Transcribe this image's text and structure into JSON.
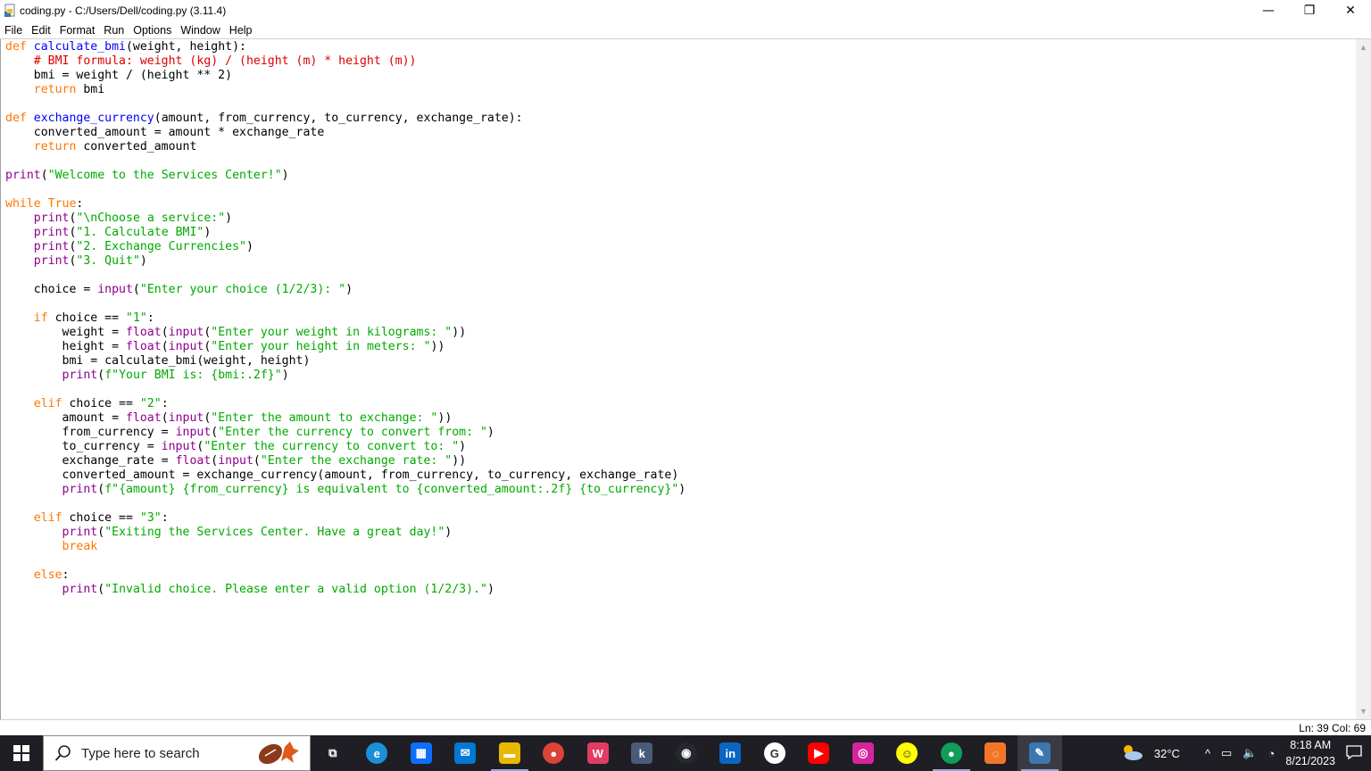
{
  "window": {
    "title": "coding.py - C:/Users/Dell/coding.py (3.11.4)",
    "minimize_symbol": "—",
    "restore_symbol": "❐",
    "close_symbol": "✕"
  },
  "menu": [
    "File",
    "Edit",
    "Format",
    "Run",
    "Options",
    "Window",
    "Help"
  ],
  "colors": {
    "keyword": "#ff7700",
    "builtin": "#900090",
    "string": "#00aa00",
    "comment": "#dd0000",
    "definition": "#0000ff",
    "taskbar": "#1e1e24"
  },
  "code_lines": [
    [
      [
        "kw",
        "def "
      ],
      [
        "df",
        "calculate_bmi"
      ],
      [
        "",
        "(weight, height):"
      ]
    ],
    [
      [
        "",
        "    "
      ],
      [
        "cm",
        "# BMI formula: weight (kg) / (height (m) * height (m))"
      ]
    ],
    [
      [
        "",
        "    bmi = weight / (height ** 2)"
      ]
    ],
    [
      [
        "",
        "    "
      ],
      [
        "kw",
        "return"
      ],
      [
        "",
        " bmi"
      ]
    ],
    [],
    [
      [
        "kw",
        "def "
      ],
      [
        "df",
        "exchange_currency"
      ],
      [
        "",
        "(amount, from_currency, to_currency, exchange_rate):"
      ]
    ],
    [
      [
        "",
        "    converted_amount = amount * exchange_rate"
      ]
    ],
    [
      [
        "",
        "    "
      ],
      [
        "kw",
        "return"
      ],
      [
        "",
        " converted_amount"
      ]
    ],
    [],
    [
      [
        "bi",
        "print"
      ],
      [
        "",
        "("
      ],
      [
        "st",
        "\"Welcome to the Services Center!\""
      ],
      [
        "",
        ")"
      ]
    ],
    [],
    [
      [
        "kw",
        "while"
      ],
      [
        "",
        " "
      ],
      [
        "kw",
        "True"
      ],
      [
        "",
        ":"
      ]
    ],
    [
      [
        "",
        "    "
      ],
      [
        "bi",
        "print"
      ],
      [
        "",
        "("
      ],
      [
        "st",
        "\"\\nChoose a service:\""
      ],
      [
        "",
        ")"
      ]
    ],
    [
      [
        "",
        "    "
      ],
      [
        "bi",
        "print"
      ],
      [
        "",
        "("
      ],
      [
        "st",
        "\"1. Calculate BMI\""
      ],
      [
        "",
        ")"
      ]
    ],
    [
      [
        "",
        "    "
      ],
      [
        "bi",
        "print"
      ],
      [
        "",
        "("
      ],
      [
        "st",
        "\"2. Exchange Currencies\""
      ],
      [
        "",
        ")"
      ]
    ],
    [
      [
        "",
        "    "
      ],
      [
        "bi",
        "print"
      ],
      [
        "",
        "("
      ],
      [
        "st",
        "\"3. Quit\""
      ],
      [
        "",
        ")"
      ]
    ],
    [],
    [
      [
        "",
        "    choice = "
      ],
      [
        "bi",
        "input"
      ],
      [
        "",
        "("
      ],
      [
        "st",
        "\"Enter your choice (1/2/3): \""
      ],
      [
        "",
        ")"
      ]
    ],
    [],
    [
      [
        "",
        "    "
      ],
      [
        "kw",
        "if"
      ],
      [
        "",
        " choice == "
      ],
      [
        "st",
        "\"1\""
      ],
      [
        "",
        ":"
      ]
    ],
    [
      [
        "",
        "        weight = "
      ],
      [
        "bi",
        "float"
      ],
      [
        "",
        "("
      ],
      [
        "bi",
        "input"
      ],
      [
        "",
        "("
      ],
      [
        "st",
        "\"Enter your weight in kilograms: \""
      ],
      [
        "",
        "))"
      ]
    ],
    [
      [
        "",
        "        height = "
      ],
      [
        "bi",
        "float"
      ],
      [
        "",
        "("
      ],
      [
        "bi",
        "input"
      ],
      [
        "",
        "("
      ],
      [
        "st",
        "\"Enter your height in meters: \""
      ],
      [
        "",
        "))"
      ]
    ],
    [
      [
        "",
        "        bmi = calculate_bmi(weight, height)"
      ]
    ],
    [
      [
        "",
        "        "
      ],
      [
        "bi",
        "print"
      ],
      [
        "",
        "("
      ],
      [
        "st",
        "f\"Your BMI is: {bmi:.2f}\""
      ],
      [
        "",
        ")"
      ]
    ],
    [],
    [
      [
        "",
        "    "
      ],
      [
        "kw",
        "elif"
      ],
      [
        "",
        " choice == "
      ],
      [
        "st",
        "\"2\""
      ],
      [
        "",
        ":"
      ]
    ],
    [
      [
        "",
        "        amount = "
      ],
      [
        "bi",
        "float"
      ],
      [
        "",
        "("
      ],
      [
        "bi",
        "input"
      ],
      [
        "",
        "("
      ],
      [
        "st",
        "\"Enter the amount to exchange: \""
      ],
      [
        "",
        "))"
      ]
    ],
    [
      [
        "",
        "        from_currency = "
      ],
      [
        "bi",
        "input"
      ],
      [
        "",
        "("
      ],
      [
        "st",
        "\"Enter the currency to convert from: \""
      ],
      [
        "",
        ")"
      ]
    ],
    [
      [
        "",
        "        to_currency = "
      ],
      [
        "bi",
        "input"
      ],
      [
        "",
        "("
      ],
      [
        "st",
        "\"Enter the currency to convert to: \""
      ],
      [
        "",
        ")"
      ]
    ],
    [
      [
        "",
        "        exchange_rate = "
      ],
      [
        "bi",
        "float"
      ],
      [
        "",
        "("
      ],
      [
        "bi",
        "input"
      ],
      [
        "",
        "("
      ],
      [
        "st",
        "\"Enter the exchange rate: \""
      ],
      [
        "",
        "))"
      ]
    ],
    [
      [
        "",
        "        converted_amount = exchange_currency(amount, from_currency, to_currency, exchange_rate)"
      ]
    ],
    [
      [
        "",
        "        "
      ],
      [
        "bi",
        "print"
      ],
      [
        "",
        "("
      ],
      [
        "st",
        "f\"{amount} {from_currency} is equivalent to {converted_amount:.2f} {to_currency}\""
      ],
      [
        "",
        ")"
      ]
    ],
    [],
    [
      [
        "",
        "    "
      ],
      [
        "kw",
        "elif"
      ],
      [
        "",
        " choice == "
      ],
      [
        "st",
        "\"3\""
      ],
      [
        "",
        ":"
      ]
    ],
    [
      [
        "",
        "        "
      ],
      [
        "bi",
        "print"
      ],
      [
        "",
        "("
      ],
      [
        "st",
        "\"Exiting the Services Center. Have a great day!\""
      ],
      [
        "",
        ")"
      ]
    ],
    [
      [
        "",
        "        "
      ],
      [
        "kw",
        "break"
      ]
    ],
    [],
    [
      [
        "",
        "    "
      ],
      [
        "kw",
        "else"
      ],
      [
        "",
        ":"
      ]
    ],
    [
      [
        "",
        "        "
      ],
      [
        "bi",
        "print"
      ],
      [
        "",
        "("
      ],
      [
        "st",
        "\"Invalid choice. Please enter a valid option (1/2/3).\""
      ],
      [
        "",
        ")"
      ]
    ]
  ],
  "status": {
    "line_col": "Ln: 39   Col: 69"
  },
  "taskbar": {
    "search_placeholder": "Type here to search",
    "apps": [
      {
        "name": "task-view-icon",
        "glyph": "⧉",
        "bg": "transparent",
        "active": false
      },
      {
        "name": "edge-icon",
        "glyph": "e",
        "bg": "#1b8fd8",
        "active": false
      },
      {
        "name": "store-icon",
        "glyph": "▦",
        "bg": "#0d6efd",
        "active": false
      },
      {
        "name": "mail-icon",
        "glyph": "✉",
        "bg": "#0078d4",
        "active": false
      },
      {
        "name": "file-explorer-icon",
        "glyph": "▬",
        "bg": "#e8b800",
        "active": true
      },
      {
        "name": "chrome-icon",
        "glyph": "●",
        "bg": "#db4437",
        "active": false
      },
      {
        "name": "wps-icon",
        "glyph": "W",
        "bg": "#e23c64",
        "active": false
      },
      {
        "name": "k-app-icon",
        "glyph": "k",
        "bg": "#4a5a7a",
        "active": false
      },
      {
        "name": "github-icon",
        "glyph": "◉",
        "bg": "#24292e",
        "active": false
      },
      {
        "name": "linkedin-icon",
        "glyph": "in",
        "bg": "#0a66c2",
        "active": false
      },
      {
        "name": "google-icon",
        "glyph": "G",
        "bg": "#ffffff",
        "active": false
      },
      {
        "name": "youtube-icon",
        "glyph": "▶",
        "bg": "#ff0000",
        "active": false
      },
      {
        "name": "instagram-icon",
        "glyph": "◎",
        "bg": "#d6249f",
        "active": false
      },
      {
        "name": "snapchat-icon",
        "glyph": "☺",
        "bg": "#fffc00",
        "active": false
      },
      {
        "name": "chrome-profile-icon",
        "glyph": "●",
        "bg": "#0f9d58",
        "active": true
      },
      {
        "name": "jupyter-icon",
        "glyph": "◌",
        "bg": "#f37626",
        "active": false
      },
      {
        "name": "idle-editor-icon",
        "glyph": "✎",
        "bg": "#3c77b0",
        "active": true,
        "focused": true
      }
    ],
    "weather": "32°C",
    "time": "8:18 AM",
    "date": "8/21/2023"
  }
}
